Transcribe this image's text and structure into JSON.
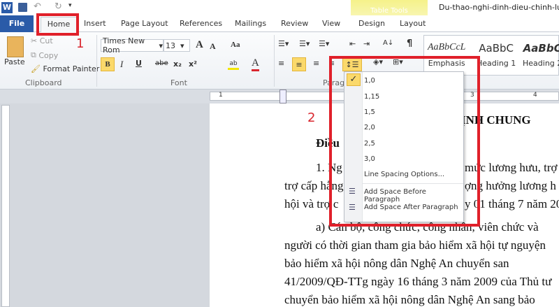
{
  "title_bar": {
    "doc_title": "Du-thao-nghi-dinh-dieu-chinh-luc",
    "table_tools": "Table Tools"
  },
  "tabs": [
    "File",
    "Home",
    "Insert",
    "Page Layout",
    "References",
    "Mailings",
    "Review",
    "View",
    "Design",
    "Layout"
  ],
  "clipboard": {
    "paste": "Paste",
    "cut": "Cut",
    "copy": "Copy",
    "format_painter": "Format Painter",
    "label": "Clipboard"
  },
  "font": {
    "name": "Times New Rom",
    "size": "13",
    "label": "Font",
    "bold": "B",
    "italic": "I",
    "underline": "U",
    "strike": "abe",
    "sub": "x₂",
    "sup": "x²",
    "grow": "A",
    "shrink": "A",
    "case": "Aa",
    "color": "A"
  },
  "paragraph": {
    "label": "Paragraph",
    "pilcrow": "¶",
    "sort": "A↓"
  },
  "styles": [
    {
      "preview": "AaBbCcL",
      "name": "Emphasis"
    },
    {
      "preview": "AaBbC",
      "name": "Heading 1"
    },
    {
      "preview": "AaBbC",
      "name": "Heading 2"
    }
  ],
  "line_spacing_menu": {
    "items": [
      "1,0",
      "1,15",
      "1,5",
      "2,0",
      "2,5",
      "3,0"
    ],
    "selected": "1,0",
    "options": "Line Spacing Options...",
    "before": "Add Space Before Paragraph",
    "after": "Add Space After Paragraph"
  },
  "annotations": {
    "step1": "1",
    "step2": "2"
  },
  "document": {
    "lines": [
      "ỊNH CHUNG",
      "Điều",
      "1. Ng",
      "mức lương hưu, trợ",
      "trợ cấp hằng",
      "ợng hưởng lương h",
      "hội và trợ c",
      "y 01 tháng 7 năm 20",
      "a) Cán bộ, công chức, công nhân, viên chức và",
      "người có thời gian tham gia bảo hiểm xã hội tự nguyện",
      "bảo  hiểm  xã  hội  nông  dân  Nghệ  An  chuyển  san",
      "41/2009/QĐ-TTg ngày 16 tháng 3 năm 2009 của Thủ tư",
      "chuyển bảo hiểm xã hội nông dân Nghệ An sang bảo"
    ]
  },
  "ruler": {
    "marks": [
      "1",
      "3",
      "4"
    ]
  },
  "colors": {
    "accent": "#2a5ba8",
    "highlight": "#fbd96b",
    "annotation": "#e0202a"
  }
}
